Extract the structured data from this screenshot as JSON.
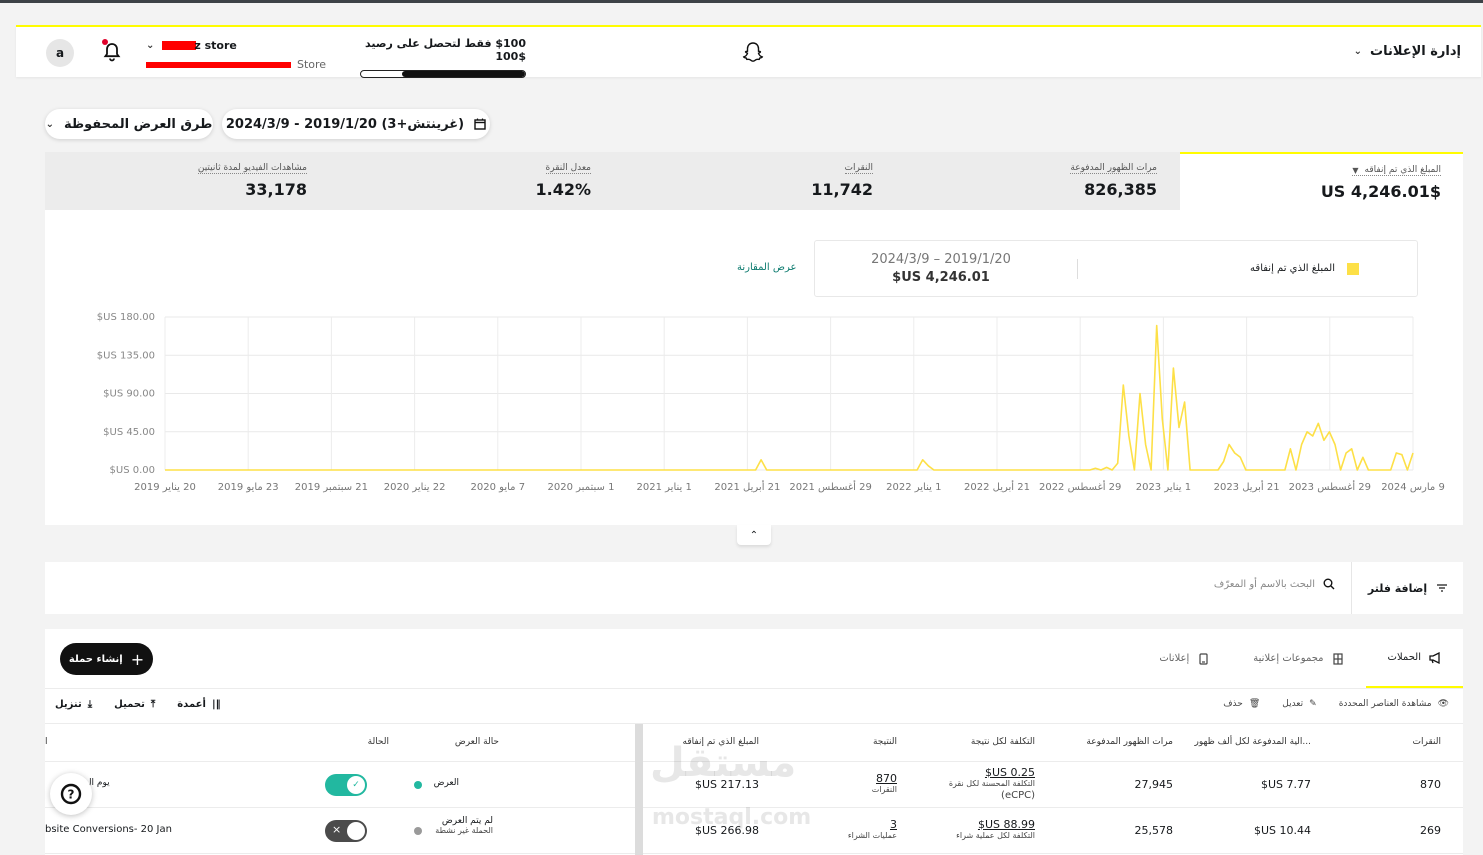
{
  "header": {
    "title": "إدارة الإعلانات",
    "credit_text": "$100 فقط لتحصل على رصيد $100",
    "credit_progress": 0.75,
    "store_name": "z store",
    "store_sub": "Store",
    "avatar_letter": "a"
  },
  "filters": {
    "date_range": "(غرينتش+3) 2019/1/20 - 2024/3/9",
    "saved_views": "طرق العرض المحفوظة"
  },
  "stats": [
    {
      "label": "المبلغ الذي تم إنفاقه",
      "value": "$US 4,246.01"
    },
    {
      "label": "مرات الظهور المدفوعة",
      "value": "826,385"
    },
    {
      "label": "النقرات",
      "value": "11,742"
    },
    {
      "label": "معدل النقرة",
      "value": "1.42%"
    },
    {
      "label": "مشاهدات الفيديو لمدة ثانيتين",
      "value": "33,178"
    }
  ],
  "legend": {
    "series_name": "المبلغ الذي تم إنفاقه",
    "range": "2024/3/9 – 2019/1/20",
    "total": "$US 4,246.01",
    "compare_link": "عرض المقارنة",
    "color": "#fde047"
  },
  "chart_data": {
    "type": "line",
    "ylim": [
      0,
      180
    ],
    "yticks": [
      "$US 0.00",
      "$US 45.00",
      "$US 90.00",
      "$US 135.00",
      "$US 180.00"
    ],
    "xticks": [
      "20 يناير 2019",
      "23 مايو 2019",
      "21 سبتمبر 2019",
      "22 يناير 2020",
      "7 مايو 2020",
      "1 سبتمبر 2020",
      "1 يناير 2021",
      "21 أبريل 2021",
      "29 أغسطس 2021",
      "1 يناير 2022",
      "21 أبريل 2022",
      "29 أغسطس 2022",
      "1 يناير 2023",
      "21 أبريل 2023",
      "29 أغسطس 2023",
      "9 مارس 2024"
    ],
    "series": [
      {
        "values": [
          0,
          0,
          0,
          0,
          0,
          0,
          0,
          0,
          0,
          0,
          0,
          0,
          0,
          0,
          0,
          0,
          0,
          0,
          0,
          0,
          0,
          0,
          0,
          0,
          0,
          0,
          0,
          0,
          0,
          0,
          0,
          0,
          0,
          0,
          0,
          0,
          0,
          0,
          0,
          0,
          0,
          0,
          0,
          0,
          0,
          0,
          0,
          0,
          0,
          0,
          0,
          0,
          0,
          0,
          0,
          0,
          0,
          0,
          0,
          0,
          0,
          0,
          0,
          0,
          0,
          0,
          0,
          0,
          0,
          0,
          0,
          0,
          0,
          0,
          0,
          0,
          0,
          0,
          0,
          0,
          0,
          0,
          0,
          0,
          0,
          0,
          0,
          0,
          0,
          0,
          0,
          0,
          0,
          0,
          0,
          0,
          0,
          0,
          0,
          0,
          0,
          0,
          0,
          0,
          0,
          0,
          0,
          12,
          0,
          0,
          0,
          0,
          0,
          0,
          0,
          0,
          0,
          0,
          0,
          0,
          0,
          0,
          0,
          0,
          0,
          0,
          0,
          0,
          0,
          0,
          0,
          0,
          0,
          0,
          0,
          0,
          12,
          5,
          0,
          0,
          0,
          0,
          0,
          0,
          0,
          0,
          0,
          0,
          0,
          0,
          0,
          0,
          0,
          0,
          0,
          0,
          0,
          0,
          0,
          0,
          0,
          0,
          0,
          0,
          0,
          0,
          0,
          2,
          0,
          3,
          0,
          8,
          100,
          40,
          0,
          90,
          30,
          0,
          170,
          60,
          0,
          120,
          50,
          80,
          0,
          0,
          0,
          0,
          0,
          0,
          10,
          30,
          20,
          15,
          0,
          0,
          0,
          0,
          0,
          0,
          0,
          0,
          25,
          0,
          30,
          45,
          40,
          55,
          35,
          45,
          30,
          0,
          20,
          25,
          0,
          15,
          0,
          0,
          0,
          0,
          0,
          20,
          18,
          0,
          20
        ]
      }
    ]
  },
  "filter_bar": {
    "add_filter": "إضافة فلتر",
    "search_placeholder": "البحث بالاسم أو المعرّف"
  },
  "tabs": [
    {
      "label": "الحملات"
    },
    {
      "label": "مجموعات إعلانية"
    },
    {
      "label": "إعلانات"
    }
  ],
  "create_button": "إنشاء حملة",
  "toolbar": {
    "view_selected": "مشاهدة العناصر المحددة",
    "edit": "تعديل",
    "delete": "حذف",
    "columns": "أعمدة",
    "upload": "تحميل",
    "download": "تنزيل"
  },
  "table": {
    "headers": {
      "clicks": "النقرات",
      "cpm": "...الية المدفوعة لكل ألف ظهور",
      "impressions": "مرات الظهور المدفوعة",
      "cost_per_result": "التكلفة لكل نتيجة",
      "result": "النتيجة",
      "spend": "المبلغ الذي تم إنفاقه",
      "delivery": "حالة العرض",
      "status": "الحالة",
      "name": "ا"
    },
    "rows": [
      {
        "clicks": "870",
        "cpm": "7.77 US$",
        "impressions": "27,945",
        "cost_per_result": "0.25 US$",
        "cost_sub1": "التكلفة المحسنة لكل نقرة",
        "cost_sub2": "(eCPC)",
        "result": "870",
        "result_sub": "النقرات",
        "spend": "217.13 US$",
        "delivery": "العرض",
        "delivery_sub": "",
        "delivery_color": "#22b8a0",
        "toggle": "on",
        "name": "يوم ال"
      },
      {
        "clicks": "269",
        "cpm": "10.44 US$",
        "impressions": "25,578",
        "cost_per_result": "88.99 US$",
        "cost_sub1": "التكلفة لكل عملية شراء",
        "cost_sub2": "",
        "result": "3",
        "result_sub": "عمليات الشراء",
        "spend": "266.98 US$",
        "delivery": "لم يتم العرض",
        "delivery_sub": "الحملة غير نشطة",
        "delivery_color": "#9a9a9a",
        "toggle": "off",
        "name": "bsite Conversions- 20 Jan"
      }
    ]
  },
  "watermark": {
    "ar": "مستقل",
    "en": "mostaql.com"
  }
}
